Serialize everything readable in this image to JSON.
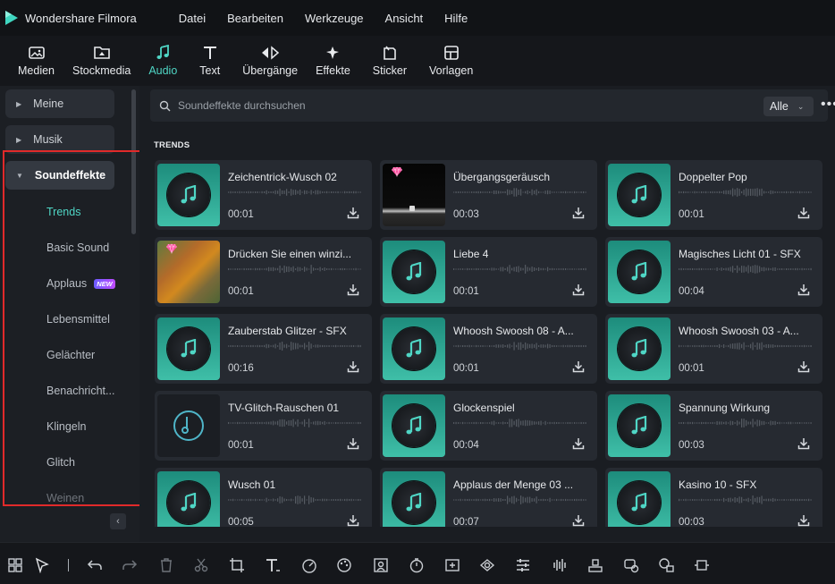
{
  "app": {
    "name": "Wondershare Filmora"
  },
  "menu": [
    "Datei",
    "Bearbeiten",
    "Werkzeuge",
    "Ansicht",
    "Hilfe"
  ],
  "toolbar": [
    {
      "label": "Medien",
      "icon": "media-icon",
      "active": false
    },
    {
      "label": "Stockmedia",
      "icon": "stock-media-icon",
      "active": false
    },
    {
      "label": "Audio",
      "icon": "music-note-icon",
      "active": true
    },
    {
      "label": "Text",
      "icon": "text-icon",
      "active": false
    },
    {
      "label": "Übergänge",
      "icon": "transition-icon",
      "active": false
    },
    {
      "label": "Effekte",
      "icon": "effects-icon",
      "active": false
    },
    {
      "label": "Sticker",
      "icon": "sticker-icon",
      "active": false
    },
    {
      "label": "Vorlagen",
      "icon": "templates-icon",
      "active": false
    }
  ],
  "sidebar": {
    "groups": [
      "Meine",
      "Musik",
      "Soundeffekte"
    ],
    "subitems": [
      {
        "label": "Trends",
        "active": true
      },
      {
        "label": "Basic Sound"
      },
      {
        "label": "Applaus",
        "badge": "NEW"
      },
      {
        "label": "Lebensmittel"
      },
      {
        "label": "Gelächter"
      },
      {
        "label": "Benachricht..."
      },
      {
        "label": "Klingeln"
      },
      {
        "label": "Glitch"
      },
      {
        "label": "Weinen"
      }
    ]
  },
  "search": {
    "placeholder": "Soundeffekte durchsuchen"
  },
  "filter": {
    "value": "Alle"
  },
  "section": {
    "title": "TRENDS"
  },
  "colors": {
    "accent": "#4fd6c5",
    "highlight": "#e12a2a"
  },
  "cards": [
    {
      "title": "Zeichentrick-Wusch 02",
      "duration": "00:01",
      "thumb": "music"
    },
    {
      "title": "Übergangsgeräusch",
      "duration": "00:03",
      "thumb": "transition",
      "premium": true
    },
    {
      "title": "Doppelter Pop",
      "duration": "00:01",
      "thumb": "music"
    },
    {
      "title": "Drücken Sie einen winzi...",
      "duration": "00:01",
      "thumb": "landscape",
      "premium": true
    },
    {
      "title": "Liebe 4",
      "duration": "00:01",
      "thumb": "music"
    },
    {
      "title": "Magisches Licht 01 - SFX",
      "duration": "00:04",
      "thumb": "music"
    },
    {
      "title": "Zauberstab Glitzer - SFX",
      "duration": "00:16",
      "thumb": "music"
    },
    {
      "title": "Whoosh Swoosh 08 - A...",
      "duration": "00:01",
      "thumb": "music"
    },
    {
      "title": "Whoosh Swoosh 03 - A...",
      "duration": "00:01",
      "thumb": "music"
    },
    {
      "title": "TV-Glitch-Rauschen 01",
      "duration": "00:01",
      "thumb": "dark"
    },
    {
      "title": "Glockenspiel",
      "duration": "00:04",
      "thumb": "music"
    },
    {
      "title": "Spannung Wirkung",
      "duration": "00:03",
      "thumb": "music"
    },
    {
      "title": "Wusch 01",
      "duration": "00:05",
      "thumb": "music"
    },
    {
      "title": "Applaus der Menge 03 ...",
      "duration": "00:07",
      "thumb": "music"
    },
    {
      "title": "Kasino 10 - SFX",
      "duration": "00:03",
      "thumb": "music"
    }
  ],
  "bottom_tools": [
    "layout-icon",
    "select-pointer-icon",
    "undo-icon",
    "redo-icon",
    "delete-icon",
    "cut-icon",
    "crop-icon",
    "text-tool-icon",
    "speed-icon",
    "color-icon",
    "ai-portrait-icon",
    "timer-icon",
    "freeze-icon",
    "mask-icon",
    "adjust-icon",
    "audio-wave-icon",
    "stabilize-icon",
    "voice-icon",
    "speech-icon",
    "trim-icon"
  ]
}
